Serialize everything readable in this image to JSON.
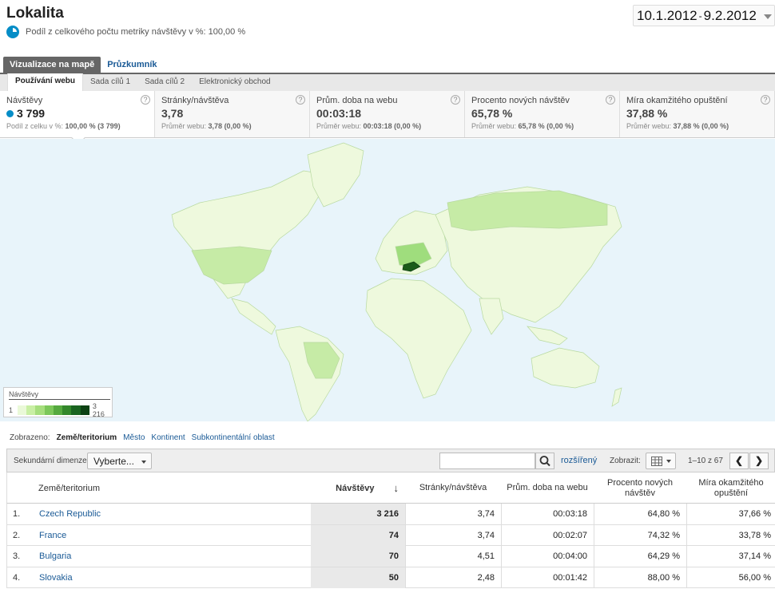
{
  "header": {
    "title": "Lokalita",
    "subtitle": "Podíl z celkového počtu metriky návštěvy v %: 100,00 %",
    "date_start": "10.1.2012",
    "date_sep": "-",
    "date_end": "9.2.2012"
  },
  "tabs": [
    {
      "label": "Vizualizace na mapě",
      "active": true
    },
    {
      "label": "Průzkumník",
      "active": false
    }
  ],
  "subtabs": [
    "Používání webu",
    "Sada cílů 1",
    "Sada cílů 2",
    "Elektronický obchod"
  ],
  "metrics": [
    {
      "name": "Návštěvy",
      "value": "3 799",
      "sub_label": "Podíl z celku v %:",
      "sub_value": "100,00 % (3 799)"
    },
    {
      "name": "Stránky/návštěva",
      "value": "3,78",
      "sub_label": "Průměr webu:",
      "sub_value": "3,78 (0,00 %)"
    },
    {
      "name": "Prům. doba na webu",
      "value": "00:03:18",
      "sub_label": "Průměr webu:",
      "sub_value": "00:03:18 (0,00 %)"
    },
    {
      "name": "Procento nových návštěv",
      "value": "65,78 %",
      "sub_label": "Průměr webu:",
      "sub_value": "65,78 % (0,00 %)"
    },
    {
      "name": "Míra okamžitého opuštění",
      "value": "37,88 %",
      "sub_label": "Průměr webu:",
      "sub_value": "37,88 % (0,00 %)"
    }
  ],
  "help_glyph": "?",
  "legend": {
    "title": "Návštěvy",
    "min": "1",
    "max": "3 216",
    "colors": [
      "#eaf9d8",
      "#c9efa4",
      "#a6de7d",
      "#7cc75a",
      "#55a93f",
      "#33872b",
      "#1a6420",
      "#0d4214"
    ]
  },
  "map_colors": {
    "ocean": "#e8f4fa",
    "land": "#eef9dd",
    "mid": "#c6eba6",
    "dark": "#9fdd7d",
    "highlight": "#1a5c1a"
  },
  "view": {
    "label": "Zobrazeno:",
    "selected": "Země/teritorium",
    "options": [
      "Město",
      "Kontinent",
      "Subkontinentální oblast"
    ]
  },
  "toolbar": {
    "secondary_label": "Sekundární dimenze:",
    "secondary_value": "Vyberte...",
    "search_placeholder": "",
    "advanced": "rozšířený",
    "show_label": "Zobrazit:",
    "pagination": "1–10 z 67",
    "prev": "❮",
    "next": "❯"
  },
  "table": {
    "headers": {
      "country": "Země/teritorium",
      "visits": "Návštěvy",
      "pages": "Stránky/návštěva",
      "duration": "Prům. doba na webu",
      "new_visits": "Procento nových návštěv",
      "bounce": "Míra okamžitého opuštění"
    },
    "sort_arrow": "↓",
    "rows": [
      {
        "num": "1.",
        "country": "Czech Republic",
        "visits": "3 216",
        "pages": "3,74",
        "duration": "00:03:18",
        "new": "64,80 %",
        "bounce": "37,66 %"
      },
      {
        "num": "2.",
        "country": "France",
        "visits": "74",
        "pages": "3,74",
        "duration": "00:02:07",
        "new": "74,32 %",
        "bounce": "33,78 %"
      },
      {
        "num": "3.",
        "country": "Bulgaria",
        "visits": "70",
        "pages": "4,51",
        "duration": "00:04:00",
        "new": "64,29 %",
        "bounce": "37,14 %"
      },
      {
        "num": "4.",
        "country": "Slovakia",
        "visits": "50",
        "pages": "2,48",
        "duration": "00:01:42",
        "new": "88,00 %",
        "bounce": "56,00 %"
      }
    ]
  }
}
